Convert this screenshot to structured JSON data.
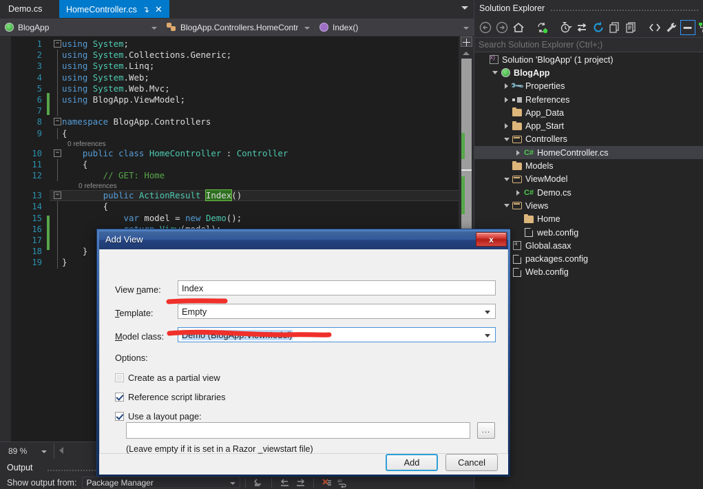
{
  "editor": {
    "tabs": [
      {
        "label": "Demo.cs",
        "active": false
      },
      {
        "label": "HomeController.cs",
        "active": true
      }
    ],
    "tab_pin_glyph": "↴",
    "tab_close_glyph": "✕",
    "nav": {
      "project": "BlogApp",
      "type": "BlogApp.Controllers.HomeContr",
      "member": "Index()"
    },
    "zoom_level": "89 %",
    "code_lines": [
      {
        "num": "1",
        "fold": "-",
        "text": "using System;"
      },
      {
        "num": "2",
        "text": "using System.Collections.Generic;"
      },
      {
        "num": "3",
        "text": "using System.Linq;"
      },
      {
        "num": "4",
        "text": "using System.Web;"
      },
      {
        "num": "5",
        "text": "using System.Web.Mvc;"
      },
      {
        "num": "6",
        "text": "using BlogApp.ViewModel;"
      },
      {
        "num": "7",
        "text": ""
      },
      {
        "num": "8",
        "fold": "-",
        "text": "namespace BlogApp.Controllers"
      },
      {
        "num": "9",
        "text": "{"
      },
      {
        "num": "10",
        "fold": "-",
        "text": "    public class HomeController : Controller",
        "codelens": "0 references"
      },
      {
        "num": "11",
        "text": "    {"
      },
      {
        "num": "12",
        "text": "        // GET: Home"
      },
      {
        "num": "13",
        "fold": "-",
        "text": "        public ActionResult Index()",
        "codelens": "0 references"
      },
      {
        "num": "14",
        "text": "        {"
      },
      {
        "num": "15",
        "text": "            var model = new Demo();"
      },
      {
        "num": "16",
        "text": "            return View(model);"
      },
      {
        "num": "17",
        "text": "        }"
      },
      {
        "num": "18",
        "text": "    }"
      },
      {
        "num": "19",
        "text": "}"
      }
    ],
    "selected_token": "Index"
  },
  "output": {
    "title": "Output",
    "show_output_from_label": "Show output from:",
    "source": "Package Manager",
    "toolbar_icons": [
      "clear-all-icon",
      "go-to-previous-message-icon",
      "go-to-next-message-icon",
      "clear-pane-icon",
      "toggle-word-wrap-icon"
    ]
  },
  "solution_explorer": {
    "title": "Solution Explorer",
    "search_placeholder": "Search Solution Explorer (Ctrl+;)",
    "toolbar_icons": [
      "back-icon",
      "forward-icon",
      "home-icon",
      "sync-with-active-document-icon",
      "pending-changes-filter-icon",
      "switch-views-icon",
      "refresh-icon",
      "collapse-all-icon",
      "show-all-files-icon",
      "view-code-icon",
      "properties-icon",
      "preview-selected-items-icon",
      "solution-hierarchy-icon"
    ],
    "tree": [
      {
        "label": "Solution 'BlogApp' (1 project)",
        "indent": 0,
        "icon": "solution-icon",
        "expander": "none",
        "bold": false,
        "selected": false
      },
      {
        "label": "BlogApp",
        "indent": 1,
        "icon": "web-project-icon",
        "expander": "open",
        "bold": true,
        "selected": false
      },
      {
        "label": "Properties",
        "indent": 2,
        "icon": "properties-wrench-icon",
        "expander": "closed",
        "bold": false,
        "selected": false
      },
      {
        "label": "References",
        "indent": 2,
        "icon": "references-icon",
        "expander": "closed",
        "bold": false,
        "selected": false
      },
      {
        "label": "App_Data",
        "indent": 2,
        "icon": "folder-icon",
        "expander": "none",
        "bold": false,
        "selected": false
      },
      {
        "label": "App_Start",
        "indent": 2,
        "icon": "folder-icon",
        "expander": "closed",
        "bold": false,
        "selected": false
      },
      {
        "label": "Controllers",
        "indent": 2,
        "icon": "folder-open-icon",
        "expander": "open",
        "bold": false,
        "selected": false
      },
      {
        "label": "HomeController.cs",
        "indent": 3,
        "icon": "csharp-file-icon",
        "expander": "closed",
        "bold": false,
        "selected": true
      },
      {
        "label": "Models",
        "indent": 2,
        "icon": "folder-icon",
        "expander": "none",
        "bold": false,
        "selected": false
      },
      {
        "label": "ViewModel",
        "indent": 2,
        "icon": "folder-open-icon",
        "expander": "open",
        "bold": false,
        "selected": false
      },
      {
        "label": "Demo.cs",
        "indent": 3,
        "icon": "csharp-file-icon",
        "expander": "closed",
        "bold": false,
        "selected": false
      },
      {
        "label": "Views",
        "indent": 2,
        "icon": "folder-open-icon",
        "expander": "open",
        "bold": false,
        "selected": false
      },
      {
        "label": "Home",
        "indent": 3,
        "icon": "folder-icon",
        "expander": "none",
        "bold": false,
        "selected": false
      },
      {
        "label": "web.config",
        "indent": 3,
        "icon": "config-file-icon",
        "expander": "none",
        "bold": false,
        "selected": false
      },
      {
        "label": "Global.asax",
        "indent": 2,
        "icon": "asax-file-icon",
        "expander": "none",
        "bold": false,
        "selected": false
      },
      {
        "label": "packages.config",
        "indent": 2,
        "icon": "config-file-icon",
        "expander": "none",
        "bold": false,
        "selected": false
      },
      {
        "label": "Web.config",
        "indent": 2,
        "icon": "config-file-icon",
        "expander": "none",
        "bold": false,
        "selected": false
      }
    ]
  },
  "dialog": {
    "title": "Add View",
    "close_glyph": "x",
    "fields": {
      "view_name_label": "View name:",
      "view_name_value": "Index",
      "template_label": "Template:",
      "template_value": "Empty",
      "model_class_label": "Model class:",
      "model_class_value": "Demo (BlogApp.ViewModel)",
      "options_label": "Options:"
    },
    "checkboxes": [
      {
        "label": "Create as a partial view",
        "checked": false
      },
      {
        "label": "Reference script libraries",
        "checked": true
      },
      {
        "label": "Use a layout page:",
        "checked": true
      }
    ],
    "layout_page_value": "",
    "browse_label": "...",
    "hint": "(Leave empty if it is set in a Razor _viewstart file)",
    "add_label": "Add",
    "cancel_label": "Cancel"
  },
  "colors": {
    "vs_chrome": "#2d2d30",
    "editor_bg": "#1e1e1e",
    "accent_blue": "#007acc",
    "dialog_face": "#f0f0f0",
    "annotation_red": "#f03028",
    "change_green": "#57a64a",
    "selection_green": "#2e6f1f",
    "selection_blue": "#bcd9f5"
  }
}
